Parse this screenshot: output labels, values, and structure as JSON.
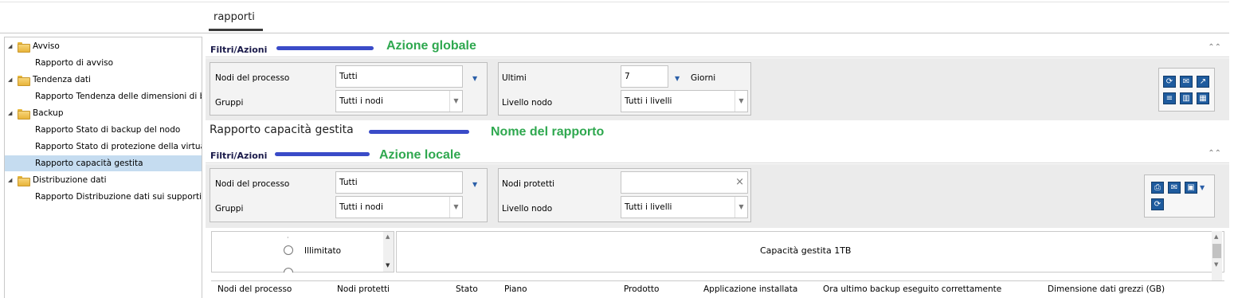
{
  "tabs": {
    "active": "rapporti"
  },
  "tree": [
    {
      "type": "folder",
      "label": "Avviso"
    },
    {
      "type": "leaf",
      "label": "Rapporto di avviso"
    },
    {
      "type": "folder",
      "label": "Tendenza dati"
    },
    {
      "type": "leaf",
      "label": "Rapporto Tendenza delle dimensioni di bac"
    },
    {
      "type": "folder",
      "label": "Backup"
    },
    {
      "type": "leaf",
      "label": "Rapporto Stato di backup del nodo"
    },
    {
      "type": "leaf",
      "label": "Rapporto Stato di protezione della virtualiz"
    },
    {
      "type": "leaf",
      "label": "Rapporto capacità gestita",
      "selected": true
    },
    {
      "type": "folder",
      "label": "Distribuzione dati"
    },
    {
      "type": "leaf",
      "label": "Rapporto Distribuzione dati sui supporti"
    }
  ],
  "global_filters": {
    "header": "Filtri/Azioni",
    "annotation": "Azione globale",
    "process_nodes_label": "Nodi del processo",
    "process_nodes_value": "Tutti",
    "groups_label": "Gruppi",
    "groups_value": "Tutti i nodi",
    "last_label": "Ultimi",
    "last_value": "7",
    "days_label": "Giorni",
    "node_level_label": "Livello nodo",
    "node_level_value": "Tutti i livelli"
  },
  "report": {
    "title": "Rapporto capacità gestita",
    "annotation": "Nome del rapporto"
  },
  "local_filters": {
    "header": "Filtri/Azioni",
    "annotation": "Azione locale",
    "process_nodes_label": "Nodi del processo",
    "process_nodes_value": "Tutti",
    "groups_label": "Gruppi",
    "groups_value": "Tutti i nodi",
    "protected_nodes_label": "Nodi protetti",
    "protected_nodes_value": "",
    "node_level_label": "Livello nodo",
    "node_level_value": "Tutti i livelli"
  },
  "capacity": {
    "radio_option": "Illimitato",
    "chart_title": "Capacità gestita 1TB"
  },
  "table": {
    "columns": [
      "Nodi del processo",
      "Nodi protetti",
      "Stato",
      "Piano",
      "Prodotto",
      "Applicazione installata",
      "Ora ultimo backup eseguito correttamente",
      "Dimensione dati grezzi (GB)"
    ]
  },
  "colors": {
    "annotation_line": "#3a4bc8",
    "annotation_text": "#2fa84f",
    "selected_row": "#c5dcf0"
  },
  "icons": {
    "global_toolbar": [
      "refresh-icon",
      "email-icon",
      "export-icon",
      "list-view-icon",
      "column-view-icon",
      "grid-view-icon"
    ],
    "local_toolbar": [
      "print-icon",
      "email-icon",
      "save-icon",
      "refresh-icon"
    ]
  }
}
